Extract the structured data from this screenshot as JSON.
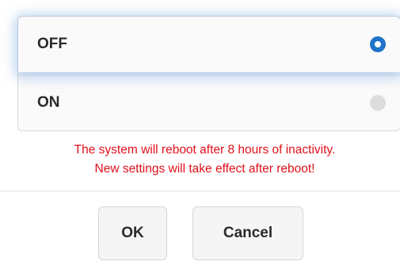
{
  "options": [
    {
      "label": "OFF",
      "selected": true
    },
    {
      "label": "ON",
      "selected": false
    }
  ],
  "notice": {
    "line1": "The system will reboot after 8 hours of inactivity.",
    "line2": "New settings will take effect after reboot!"
  },
  "buttons": {
    "ok_label": "OK",
    "cancel_label": "Cancel"
  },
  "colors": {
    "accent": "#1f73c8",
    "warning_text": "#e0101a"
  }
}
